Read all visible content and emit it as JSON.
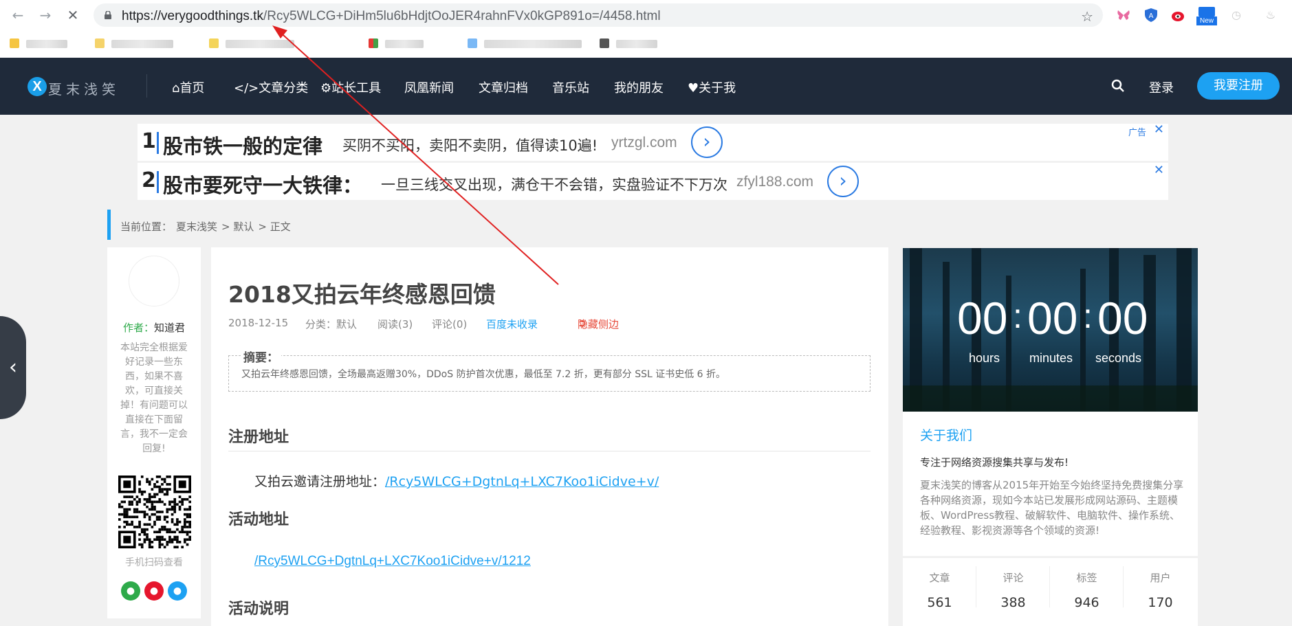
{
  "browser": {
    "url_host": "https://verygoodthings.tk",
    "url_path": "/Rcy5WLCG+DiHm5lu6bHdjtOoJER4rahnFVx0kGP891o=/4458.html",
    "ext_new_badge": "New"
  },
  "site": {
    "logo_letter": "X",
    "logo_text": "夏末浅笑",
    "menu": [
      "首页",
      "文章分类",
      "站长工具",
      "凤凰新闻",
      "文章归档",
      "音乐站",
      "我的朋友",
      "关于我"
    ],
    "menu_prefix": [
      "⌂",
      "</>",
      "⚙",
      "",
      "",
      "",
      "",
      "♥"
    ],
    "login": "登录",
    "register": "我要注册"
  },
  "ads": [
    {
      "num": "1",
      "title": "股市铁一般的定律",
      "desc": "买阴不买阳，卖阳不卖阴，值得读10遍!",
      "domain": "yrtzgl.com",
      "tag": "广告"
    },
    {
      "num": "2",
      "title": "股市要死守一大铁律：",
      "desc": "一旦三线交叉出现，满仓干不会错，实盘验证不下万次",
      "domain": "zfyl188.com",
      "tag": ""
    }
  ],
  "breadcrumb": {
    "label": "当前位置：",
    "home": "夏末浅笑",
    "cat": "> 默认",
    "cur": "> 正文"
  },
  "author": {
    "label": "作者：",
    "name": "知道君",
    "bio": "本站完全根据爱好记录一些东西，如果不喜欢，可直接关掉！有问题可以直接在下面留言，我不一定会回复!",
    "qr_caption": "手机扫码查看"
  },
  "article": {
    "title": "2018又拍云年终感恩回馈",
    "date": "2018-12-15",
    "category": "分类：默认",
    "reads": "阅读(3)",
    "comments": "评论(0)",
    "baidu": "百度未收录",
    "hide_sidebar": "隐藏侧边",
    "abstract_label": "摘要：",
    "abstract": "又拍云年终感恩回馈，全场最高返赠30%，DDoS 防护首次优惠，最低至 7.2 折，更有部分 SSL 证书史低 6 折。",
    "h_register": "注册地址",
    "register_prefix": "又拍云邀请注册地址：",
    "register_link": "/Rcy5WLCG+DgtnLq+LXC7Koo1iCidve+v/",
    "h_activity": "活动地址",
    "activity_link": "/Rcy5WLCG+DgtnLq+LXC7Koo1iCidve+v/1212",
    "h_desc": "活动说明"
  },
  "countdown": {
    "hours": "00",
    "minutes": "00",
    "seconds": "00",
    "hours_label": "hours",
    "minutes_label": "minutes",
    "seconds_label": "seconds",
    "sep": ":"
  },
  "about": {
    "title": "关于我们",
    "subtitle": "专注于网络资源搜集共享与发布!",
    "text": "夏末浅笑的博客从2015年开始至今始终坚持免费搜集分享各种网络资源，现如今本站已发展形成网站源码、主题模板、WordPress教程、破解软件、电脑软件、操作系统、经验教程、影视资源等各个领域的资源!"
  },
  "stats": [
    {
      "label": "文章",
      "value": "561"
    },
    {
      "label": "评论",
      "value": "388"
    },
    {
      "label": "标签",
      "value": "946"
    },
    {
      "label": "用户",
      "value": "170"
    }
  ],
  "colors": {
    "accent": "#1da1f2",
    "header": "#1f2a3a",
    "annotation": "#e02020"
  }
}
